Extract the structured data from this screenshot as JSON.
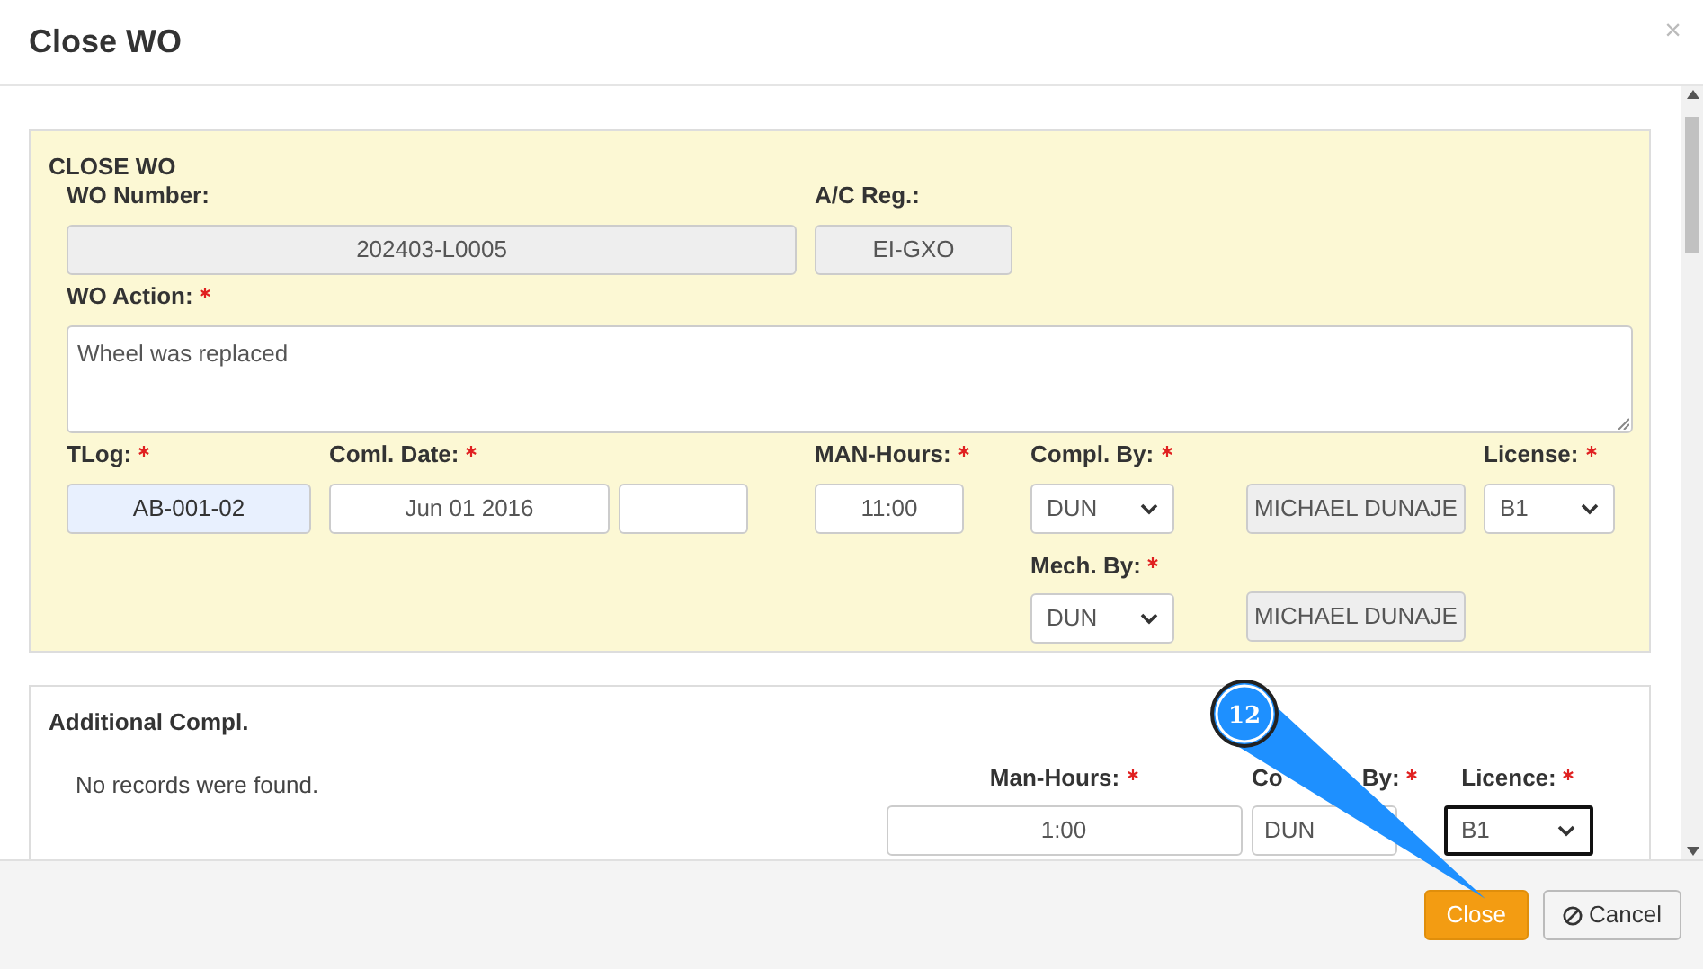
{
  "window": {
    "title": "Close WO",
    "close_glyph": "×"
  },
  "close_wo": {
    "heading": "CLOSE WO",
    "wo_number": {
      "label": "WO Number:",
      "value": "202403-L0005"
    },
    "ac_reg": {
      "label": "A/C Reg.:",
      "value": "EI-GXO"
    },
    "wo_action": {
      "label": "WO Action:",
      "required": true,
      "value": "Wheel was replaced"
    },
    "tlog": {
      "label": "TLog:",
      "required": true,
      "value": "AB-001-02"
    },
    "coml_date": {
      "label": "Coml. Date:",
      "required": true,
      "value": "Jun 01 2016"
    },
    "man_hours": {
      "label": "MAN-Hours:",
      "required": true,
      "value": "11:00"
    },
    "compl_by": {
      "label": "Compl. By:",
      "required": true,
      "value": "DUN",
      "name": "MICHAEL DUNAJE"
    },
    "license": {
      "label": "License:",
      "required": true,
      "value": "B1"
    },
    "mech_by": {
      "label": "Mech. By:",
      "required": true,
      "value": "DUN",
      "name": "MICHAEL DUNAJE"
    }
  },
  "additional": {
    "heading": "Additional Compl.",
    "empty_text": "No records were found.",
    "man_hours": {
      "label": "Man-Hours:",
      "required": true,
      "value": "1:00"
    },
    "compl_by": {
      "label_parts": [
        "Co",
        "By:"
      ],
      "required": true,
      "value": "DUN"
    },
    "licence": {
      "label": "Licence:",
      "required": true,
      "value": "B1"
    }
  },
  "callout": {
    "number": "12"
  },
  "buttons": [
    {
      "kind": "primary",
      "label": "Close"
    },
    {
      "kind": "cancel",
      "label": "Cancel"
    }
  ]
}
